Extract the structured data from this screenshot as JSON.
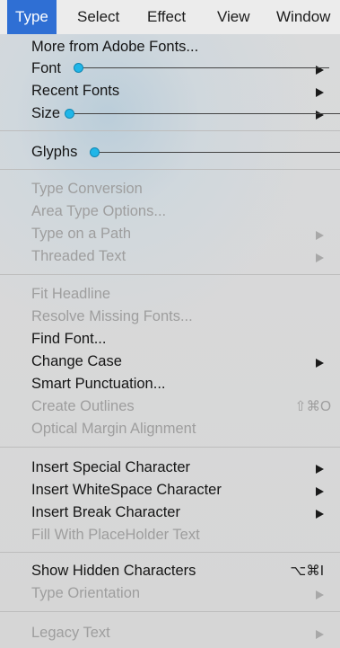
{
  "menubar": {
    "items": [
      {
        "label": "Type",
        "active": true
      },
      {
        "label": "Select"
      },
      {
        "label": "Effect"
      },
      {
        "label": "View"
      },
      {
        "label": "Window"
      }
    ]
  },
  "accent_colors": {
    "menu_highlight": "#2f6fd4",
    "annotation_dot": "#20b6e8"
  },
  "menu": {
    "more_adobe_fonts": "More from Adobe Fonts...",
    "font": "Font",
    "recent_fonts": "Recent Fonts",
    "size": "Size",
    "glyphs": "Glyphs",
    "type_conversion": "Type Conversion",
    "area_type_options": "Area Type Options...",
    "type_on_path": "Type on a Path",
    "threaded_text": "Threaded Text",
    "fit_headline": "Fit Headline",
    "resolve_missing_fonts": "Resolve Missing Fonts...",
    "find_font": "Find Font...",
    "change_case": "Change Case",
    "smart_punctuation": "Smart Punctuation...",
    "create_outlines": "Create Outlines",
    "create_outlines_shortcut": "⇧⌘O",
    "optical_margin_alignment": "Optical Margin Alignment",
    "insert_special_character": "Insert Special Character",
    "insert_whitespace_character": "Insert WhiteSpace Character",
    "insert_break_character": "Insert Break Character",
    "fill_placeholder_text": "Fill With PlaceHolder Text",
    "show_hidden_characters": "Show Hidden Characters",
    "show_hidden_characters_shortcut": "⌥⌘I",
    "type_orientation": "Type Orientation",
    "legacy_text": "Legacy Text"
  }
}
